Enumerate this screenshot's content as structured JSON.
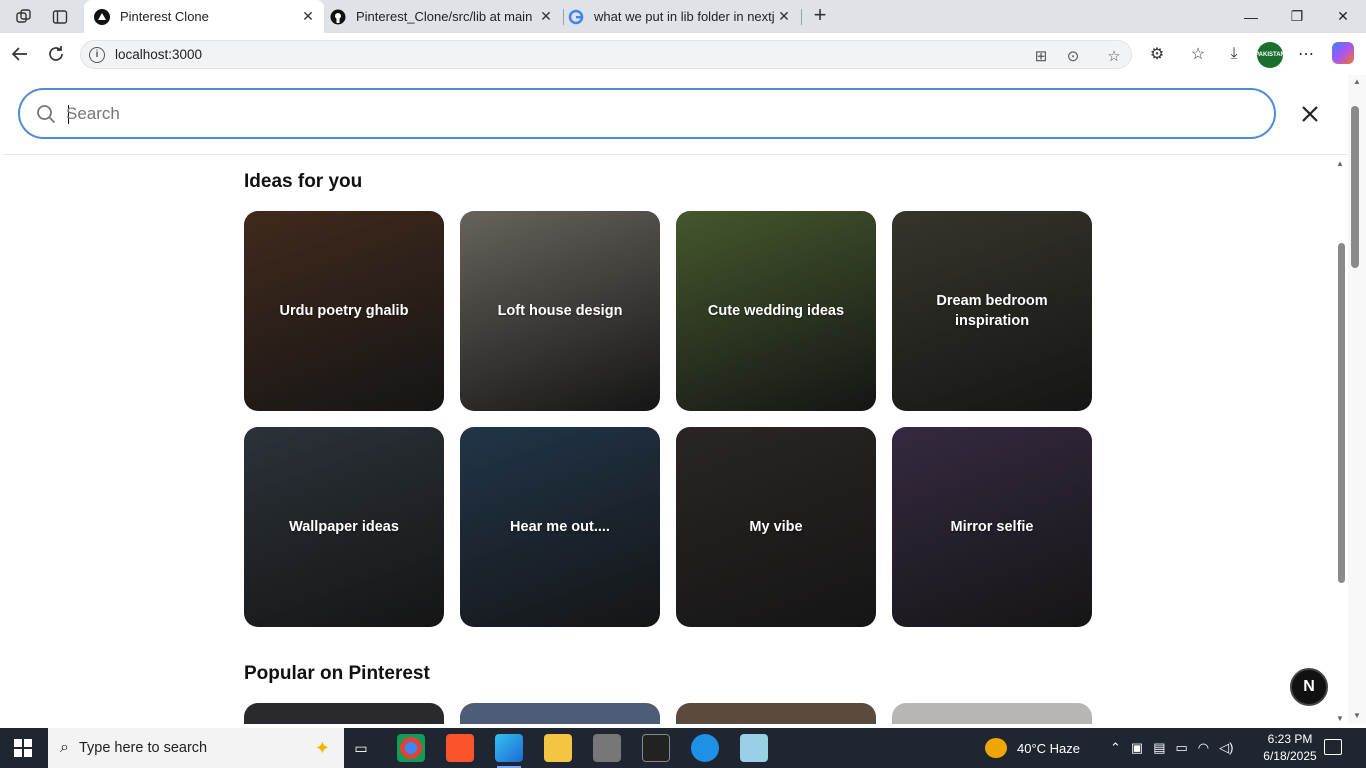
{
  "browser": {
    "tabs": [
      {
        "title": "Pinterest Clone",
        "icon": "nextjs-triangle-icon",
        "active": true
      },
      {
        "title": "Pinterest_Clone/src/lib at main · N",
        "icon": "github-icon",
        "active": false
      },
      {
        "title": "what we put in lib folder in nextjs",
        "icon": "google-icon",
        "active": false
      }
    ],
    "url": "localhost:3000",
    "profile_badge": "PAKISTAN"
  },
  "search": {
    "placeholder": "Search",
    "value": ""
  },
  "sections": {
    "ideas_title": "Ideas for you",
    "popular_title": "Popular on Pinterest"
  },
  "ideas": [
    {
      "label": "Urdu poetry ghalib",
      "color": "#5a3a28"
    },
    {
      "label": "Loft house design",
      "color": "#8f8a80"
    },
    {
      "label": "Cute wedding ideas",
      "color": "#5f7a3e"
    },
    {
      "label": "Dream bedroom inspiration",
      "color": "#4b4a3c"
    },
    {
      "label": "Wallpaper ideas",
      "color": "#3c4650"
    },
    {
      "label": "Hear me out....",
      "color": "#2e4a66"
    },
    {
      "label": "My vibe",
      "color": "#3a3432"
    },
    {
      "label": "Mirror selfie",
      "color": "#4a3a5a"
    }
  ],
  "popular_preview_colors": [
    "#2a2a2e",
    "#4e5c78",
    "#5b4a3e",
    "#b8b6b2"
  ],
  "next_badge": "N",
  "taskbar": {
    "search_placeholder": "Type here to search",
    "weather": "40°C  Haze",
    "time": "6:23 PM",
    "date": "6/18/2025"
  }
}
